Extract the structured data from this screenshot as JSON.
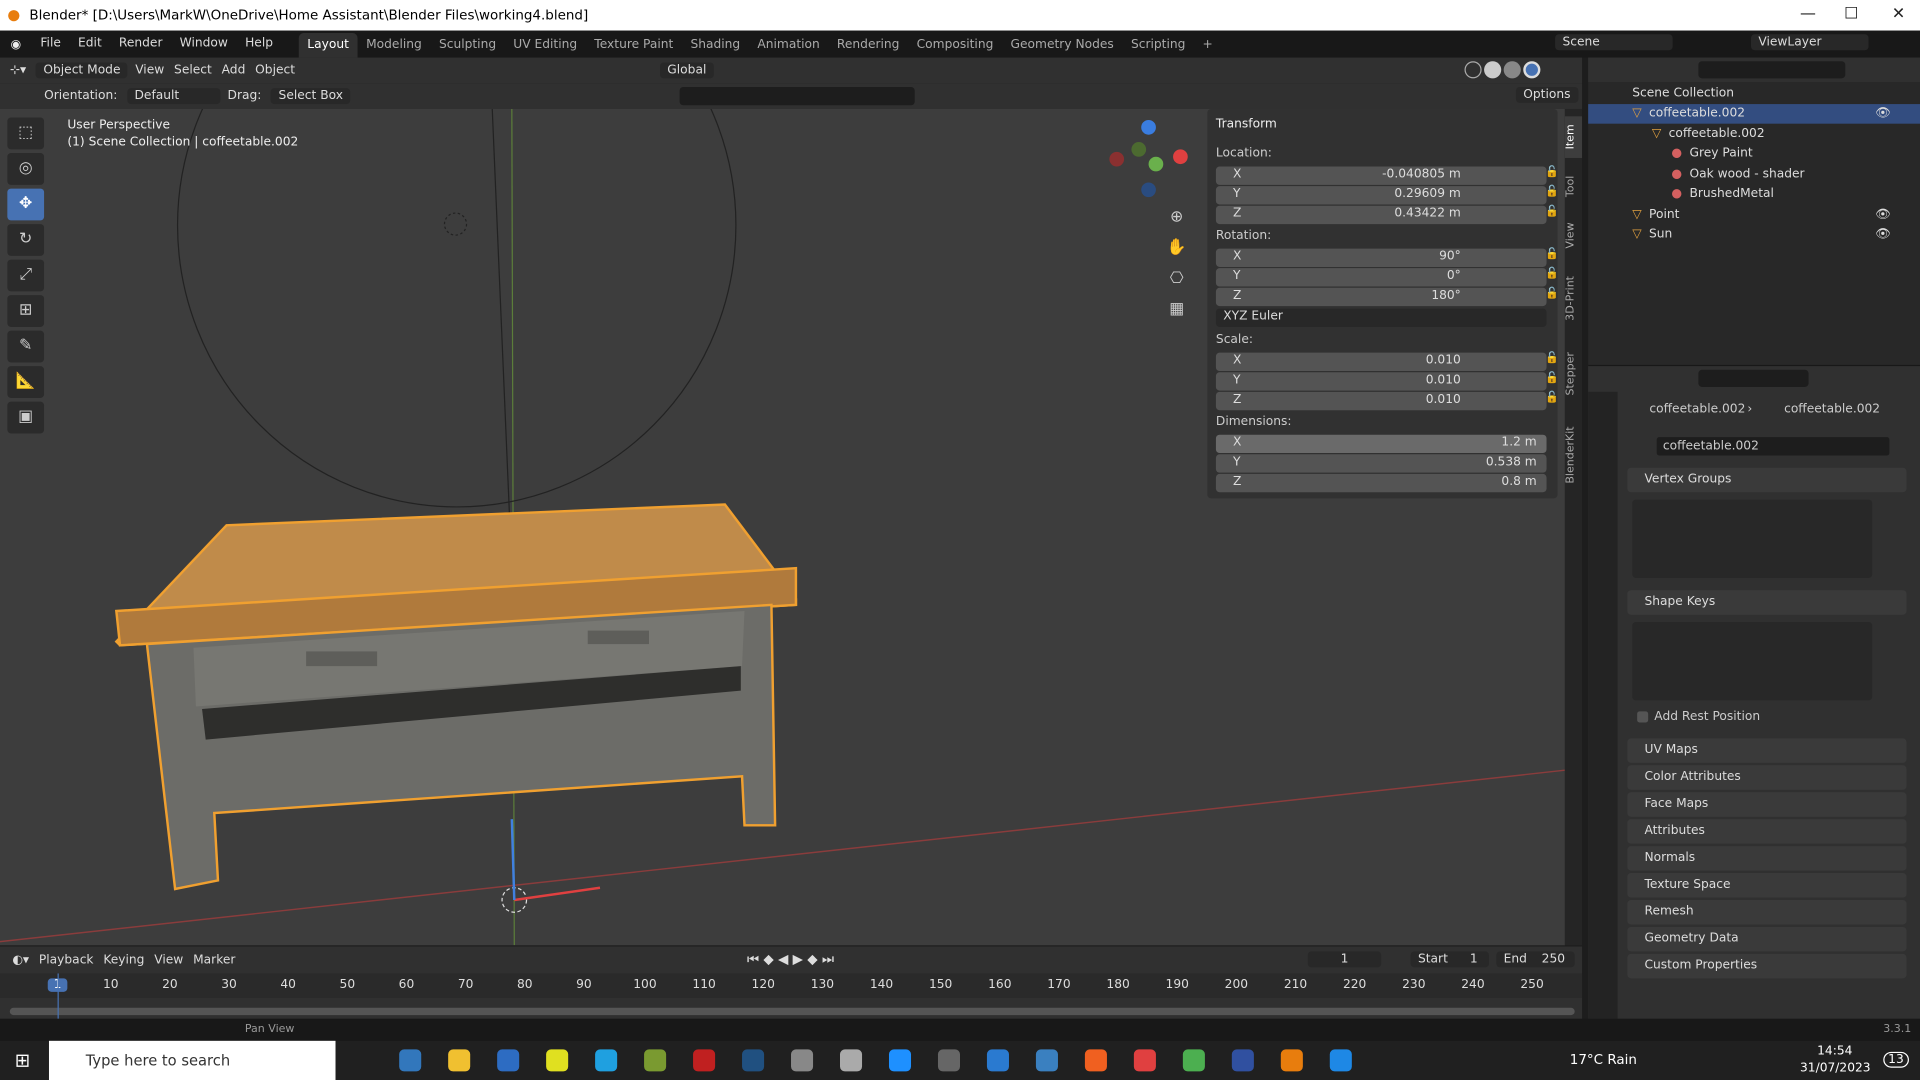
{
  "window": {
    "title": "Blender* [D:\\Users\\MarkW\\OneDrive\\Home Assistant\\Blender Files\\working4.blend]",
    "minimize": "—",
    "maximize": "☐",
    "close": "✕"
  },
  "menu": [
    "File",
    "Edit",
    "Render",
    "Window",
    "Help"
  ],
  "workspaces": [
    "Layout",
    "Modeling",
    "Sculpting",
    "UV Editing",
    "Texture Paint",
    "Shading",
    "Animation",
    "Rendering",
    "Compositing",
    "Geometry Nodes",
    "Scripting",
    "+"
  ],
  "scene": "Scene",
  "view_layer": "ViewLayer",
  "viewport_header": {
    "mode": "Object Mode",
    "items": [
      "View",
      "Select",
      "Add",
      "Object"
    ],
    "transform_orientation": "Global"
  },
  "tool_settings": {
    "orientation_label": "Orientation:",
    "orientation": "Default",
    "drag_label": "Drag:",
    "drag": "Select Box",
    "options": "Options"
  },
  "overlay": {
    "view_name": "User Perspective",
    "collection": "(1) Scene Collection | coffeetable.002"
  },
  "transform": {
    "title": "Transform",
    "location_label": "Location:",
    "location": [
      {
        "axis": "X",
        "value": "-0.040805 m"
      },
      {
        "axis": "Y",
        "value": "0.29609 m"
      },
      {
        "axis": "Z",
        "value": "0.43422 m"
      }
    ],
    "rotation_label": "Rotation:",
    "rotation": [
      {
        "axis": "X",
        "value": "90°"
      },
      {
        "axis": "Y",
        "value": "0°"
      },
      {
        "axis": "Z",
        "value": "180°"
      }
    ],
    "rotation_mode": "XYZ Euler",
    "scale_label": "Scale:",
    "scale": [
      {
        "axis": "X",
        "value": "0.010"
      },
      {
        "axis": "Y",
        "value": "0.010"
      },
      {
        "axis": "Z",
        "value": "0.010"
      }
    ],
    "dimensions_label": "Dimensions:",
    "dimensions": [
      {
        "axis": "X",
        "value": "1.2 m"
      },
      {
        "axis": "Y",
        "value": "0.538 m"
      },
      {
        "axis": "Z",
        "value": "0.8 m"
      }
    ]
  },
  "sidebar_tabs": [
    "Item",
    "Tool",
    "View",
    "3D-Print",
    "Stepper",
    "BlenderKit"
  ],
  "outliner": {
    "root": "Scene Collection",
    "items": [
      {
        "name": "coffeetable.002",
        "level": 1,
        "selected": true
      },
      {
        "name": "coffeetable.002",
        "level": 2
      },
      {
        "name": "Grey Paint",
        "level": 3
      },
      {
        "name": "Oak wood - shader",
        "level": 3
      },
      {
        "name": "BrushedMetal",
        "level": 3
      },
      {
        "name": "Point",
        "level": 1
      },
      {
        "name": "Sun",
        "level": 1
      }
    ]
  },
  "properties": {
    "breadcrumb_object": "coffeetable.002",
    "breadcrumb_data": "coffeetable.002",
    "mesh_name": "coffeetable.002",
    "vertex_groups": "Vertex Groups",
    "shape_keys": "Shape Keys",
    "add_rest_position": "Add Rest Position",
    "panels": [
      "UV Maps",
      "Color Attributes",
      "Face Maps",
      "Attributes",
      "Normals",
      "Texture Space",
      "Remesh",
      "Geometry Data",
      "Custom Properties"
    ]
  },
  "timeline": {
    "menus": [
      "Playback",
      "Keying",
      "View",
      "Marker"
    ],
    "current_frame": "1",
    "start_label": "Start",
    "start": "1",
    "end_label": "End",
    "end": "250",
    "ticks": [
      "1",
      "10",
      "20",
      "30",
      "40",
      "50",
      "60",
      "70",
      "80",
      "90",
      "100",
      "110",
      "120",
      "130",
      "140",
      "150",
      "160",
      "170",
      "180",
      "190",
      "200",
      "210",
      "220",
      "230",
      "240",
      "250"
    ]
  },
  "status": {
    "hint": "Pan View",
    "version": "3.3.1"
  },
  "taskbar": {
    "search_placeholder": "Type here to search",
    "weather": "17°C  Rain",
    "time": "14:54",
    "date": "31/07/2023",
    "notifications": "13"
  },
  "colors": {
    "accent": "#4772b3",
    "selection": "#f0a030",
    "viewport": "#3d3d3d"
  }
}
